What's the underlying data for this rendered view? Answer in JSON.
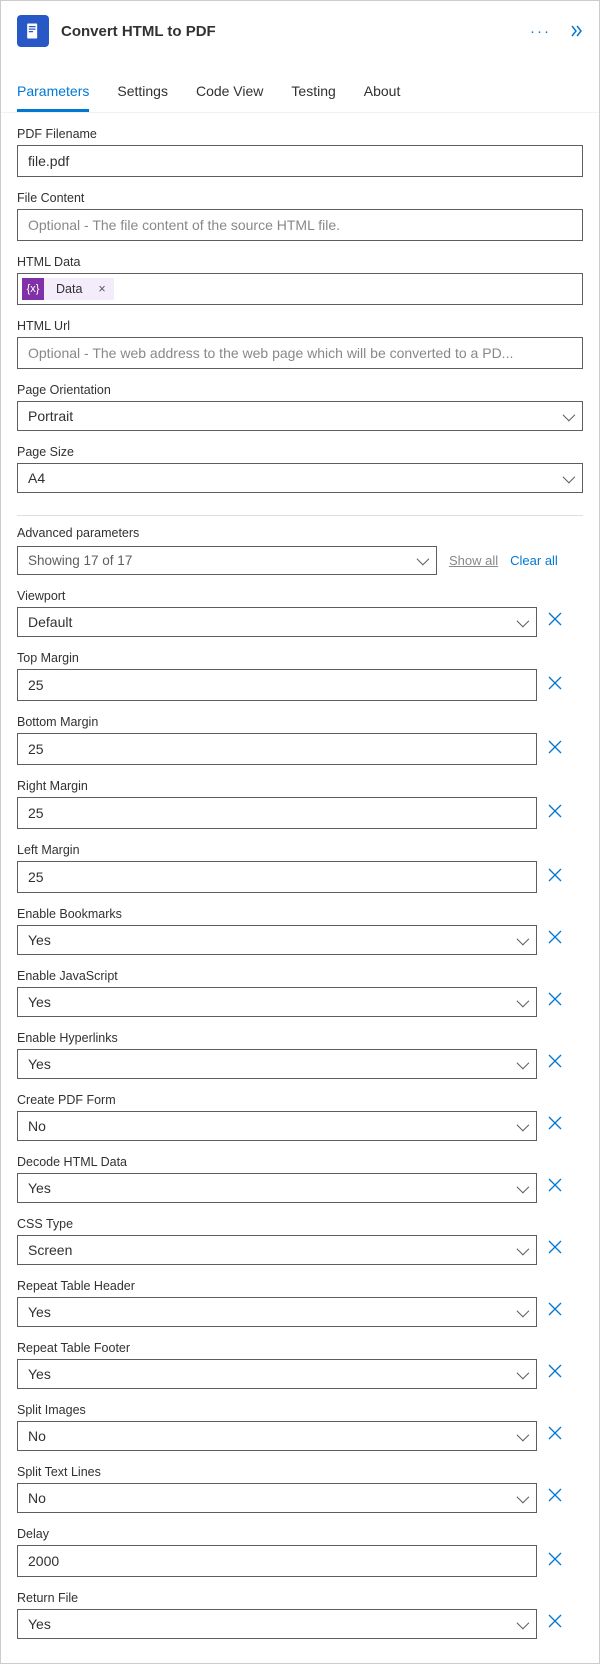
{
  "header": {
    "title": "Convert HTML to PDF"
  },
  "tabs": {
    "parameters": "Parameters",
    "settings": "Settings",
    "codeview": "Code View",
    "testing": "Testing",
    "about": "About"
  },
  "fields": {
    "pdf_filename": {
      "label": "PDF Filename",
      "value": "file.pdf"
    },
    "file_content": {
      "label": "File Content",
      "placeholder": "Optional - The file content of the source HTML file."
    },
    "html_data": {
      "label": "HTML Data",
      "token": "Data"
    },
    "html_url": {
      "label": "HTML Url",
      "placeholder": "Optional - The web address to the web page which will be converted to a PD..."
    },
    "page_orientation": {
      "label": "Page Orientation",
      "value": "Portrait"
    },
    "page_size": {
      "label": "Page Size",
      "value": "A4"
    }
  },
  "advanced": {
    "header": "Advanced parameters",
    "summary": "Showing 17 of 17",
    "show_all": "Show all",
    "clear_all": "Clear all",
    "params": [
      {
        "label": "Viewport",
        "type": "select",
        "value": "Default"
      },
      {
        "label": "Top Margin",
        "type": "text",
        "value": "25"
      },
      {
        "label": "Bottom Margin",
        "type": "text",
        "value": "25"
      },
      {
        "label": "Right Margin",
        "type": "text",
        "value": "25"
      },
      {
        "label": "Left Margin",
        "type": "text",
        "value": "25"
      },
      {
        "label": "Enable Bookmarks",
        "type": "select",
        "value": "Yes"
      },
      {
        "label": "Enable JavaScript",
        "type": "select",
        "value": "Yes"
      },
      {
        "label": "Enable Hyperlinks",
        "type": "select",
        "value": "Yes"
      },
      {
        "label": "Create PDF Form",
        "type": "select",
        "value": "No"
      },
      {
        "label": "Decode HTML Data",
        "type": "select",
        "value": "Yes"
      },
      {
        "label": "CSS Type",
        "type": "select",
        "value": "Screen"
      },
      {
        "label": "Repeat Table Header",
        "type": "select",
        "value": "Yes"
      },
      {
        "label": "Repeat Table Footer",
        "type": "select",
        "value": "Yes"
      },
      {
        "label": "Split Images",
        "type": "select",
        "value": "No"
      },
      {
        "label": "Split Text Lines",
        "type": "select",
        "value": "No"
      },
      {
        "label": "Delay",
        "type": "text",
        "value": "2000"
      },
      {
        "label": "Return File",
        "type": "select",
        "value": "Yes"
      }
    ]
  }
}
